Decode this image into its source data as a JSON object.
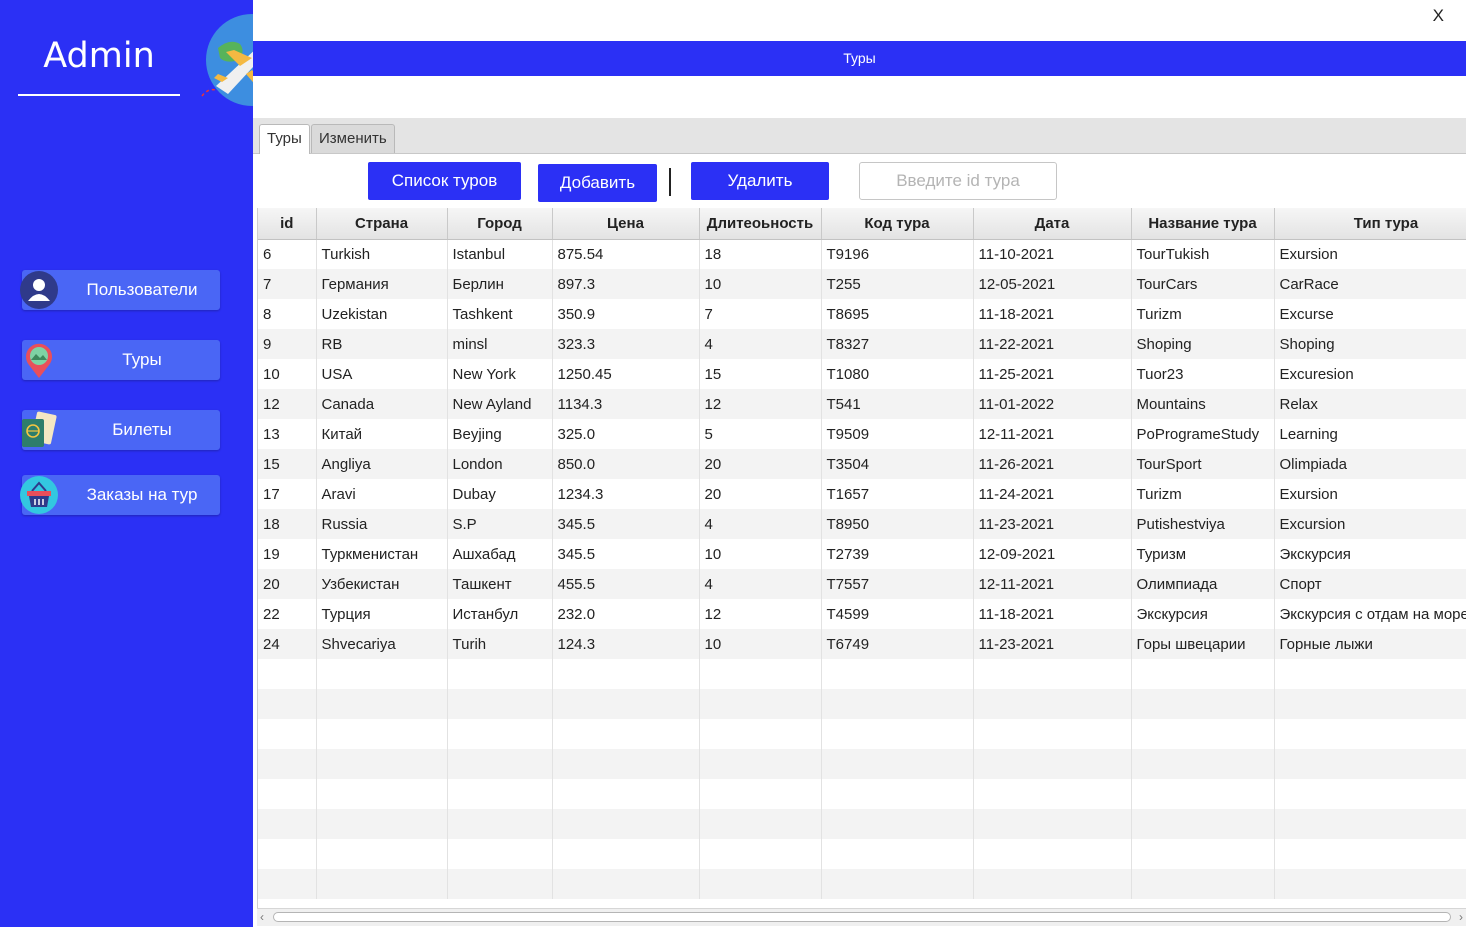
{
  "sidebar": {
    "title": "Admin",
    "items": [
      {
        "label": "Пользователи",
        "icon": "user-icon"
      },
      {
        "label": "Туры",
        "icon": "map-pin-icon"
      },
      {
        "label": "Билеты",
        "icon": "ticket-passport-icon"
      },
      {
        "label": "Заказы на тур",
        "icon": "basket-icon"
      }
    ]
  },
  "window": {
    "close_label": "X",
    "title": "Туры"
  },
  "tabs": [
    {
      "label": "Туры",
      "active": true
    },
    {
      "label": "Изменить",
      "active": false
    }
  ],
  "toolbar": {
    "list_label": "Список туров",
    "add_label": "Добавить",
    "delete_label": "Удалить",
    "id_placeholder": "Введите id тура"
  },
  "table": {
    "columns": [
      "id",
      "Страна",
      "Город",
      "Цена",
      "Длитеоьность",
      "Код тура",
      "Дата",
      "Название тура",
      "Тип тура"
    ],
    "rows": [
      [
        "6",
        "Turkish",
        "Istanbul",
        "875.54",
        "18",
        "T9196",
        "11-10-2021",
        "TourTukish",
        "Exursion"
      ],
      [
        "7",
        "Германия",
        "Берлин",
        "897.3",
        "10",
        "T255",
        "12-05-2021",
        "TourCars",
        "CarRace"
      ],
      [
        "8",
        "Uzekistan",
        "Tashkent",
        "350.9",
        "7",
        "T8695",
        "11-18-2021",
        "Turizm",
        "Excurse"
      ],
      [
        "9",
        "RB",
        "minsl",
        "323.3",
        "4",
        "T8327",
        "11-22-2021",
        "Shoping",
        "Shoping"
      ],
      [
        "10",
        "USA",
        "New York",
        "1250.45",
        "15",
        "T1080",
        "11-25-2021",
        "Tuor23",
        "Excuresion"
      ],
      [
        "12",
        "Canada",
        "New Ayland",
        "1134.3",
        "12",
        "T541",
        "11-01-2022",
        "Mountains",
        "Relax"
      ],
      [
        "13",
        "Китай",
        "Beyjing",
        "325.0",
        "5",
        "T9509",
        "12-11-2021",
        "PoProgrameStudy",
        "Learning"
      ],
      [
        "15",
        "Angliya",
        "London",
        "850.0",
        "20",
        "T3504",
        "11-26-2021",
        "TourSport",
        "Olimpiada"
      ],
      [
        "17",
        "Aravi",
        "Dubay",
        "1234.3",
        "20",
        "T1657",
        "11-24-2021",
        "Turizm",
        "Exursion"
      ],
      [
        "18",
        "Russia",
        "S.P",
        "345.5",
        "4",
        "T8950",
        "11-23-2021",
        "Putishestviya",
        "Excursion"
      ],
      [
        "19",
        "Туркменистан",
        "Ашхабад",
        "345.5",
        "10",
        "T2739",
        "12-09-2021",
        "Туризм",
        "Экскурсия"
      ],
      [
        "20",
        "Узбекистан",
        "Ташкент",
        "455.5",
        "4",
        "T7557",
        "12-11-2021",
        "Олимпиада",
        "Спорт"
      ],
      [
        "22",
        "Турция",
        "Истанбул",
        "232.0",
        "12",
        "T4599",
        "11-18-2021",
        "Экскурсия",
        "Экскурсия с отдам на море"
      ],
      [
        "24",
        "Shvecariya",
        "Turih",
        "124.3",
        "10",
        "T6749",
        "11-23-2021",
        "Горы швецарии",
        "Горные лыжи"
      ]
    ]
  },
  "colors": {
    "accent": "#2b30f5",
    "nav_button": "#4a66f5"
  }
}
